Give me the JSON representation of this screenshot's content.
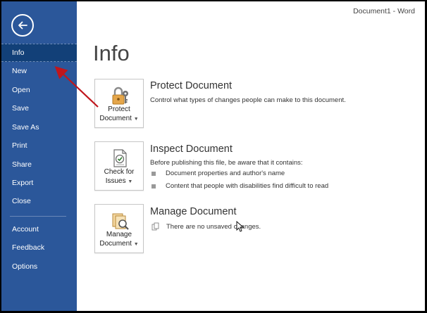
{
  "window": {
    "title": "Document1  -  Word"
  },
  "sidebar": {
    "items": [
      {
        "label": "Info",
        "active": true
      },
      {
        "label": "New"
      },
      {
        "label": "Open"
      },
      {
        "label": "Save"
      },
      {
        "label": "Save As"
      },
      {
        "label": "Print"
      },
      {
        "label": "Share"
      },
      {
        "label": "Export"
      },
      {
        "label": "Close"
      },
      {
        "label": "Account"
      },
      {
        "label": "Feedback"
      },
      {
        "label": "Options"
      }
    ],
    "icons": {
      "back": "back-arrow-icon"
    }
  },
  "main": {
    "title": "Info",
    "protect": {
      "button_line1": "Protect",
      "button_line2": "Document",
      "title": "Protect Document",
      "desc": "Control what types of changes people can make to this document.",
      "icon": "lock-key-icon"
    },
    "inspect": {
      "button_line1": "Check for",
      "button_line2": "Issues",
      "title": "Inspect Document",
      "desc": "Before publishing this file, be aware that it contains:",
      "bullets": [
        "Document properties and author's name",
        "Content that people with disabilities find difficult to read"
      ],
      "icon": "check-document-icon"
    },
    "manage": {
      "button_line1": "Manage",
      "button_line2": "Document",
      "title": "Manage Document",
      "desc": "There are no unsaved changes.",
      "icon": "manage-document-icon"
    }
  },
  "colors": {
    "sidebar_bg": "#2b579a",
    "sidebar_active": "#124078",
    "annotation_arrow": "#c0161c"
  }
}
